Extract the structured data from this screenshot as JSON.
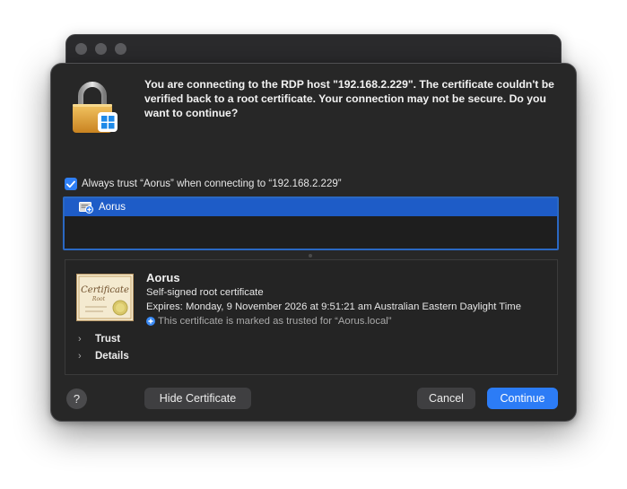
{
  "background_window": {
    "traffic_lights": [
      "close",
      "minimize",
      "zoom"
    ]
  },
  "dialog": {
    "icon": "lock-windows-icon",
    "message": "You are connecting to the RDP host \"192.168.2.229\". The certificate couldn't be verified back to a root certificate. Your connection may not be secure. Do you want to continue?",
    "always_trust": {
      "checked": true,
      "label": "Always trust “Aorus” when connecting to “192.168.2.229”"
    },
    "cert_list": [
      {
        "label": "Aorus",
        "selected": true,
        "icon": "certificate-list-icon"
      }
    ],
    "certificate": {
      "image_text": {
        "line1": "Certificate",
        "line2": "Root"
      },
      "name": "Aorus",
      "type": "Self-signed root certificate",
      "expires": "Expires: Monday, 9 November 2026 at 9:51:21 am Australian Eastern Daylight Time",
      "trusted_note": "This certificate is marked as trusted for “Aorus.local”",
      "sections": [
        {
          "label": "Trust",
          "expanded": false
        },
        {
          "label": "Details",
          "expanded": false
        }
      ]
    },
    "buttons": {
      "help": "?",
      "hide_certificate": "Hide Certificate",
      "cancel": "Cancel",
      "continue": "Continue"
    },
    "colors": {
      "accent": "#2c7cf6",
      "selection": "#1e5cc7",
      "sheet_bg": "#272727"
    }
  }
}
